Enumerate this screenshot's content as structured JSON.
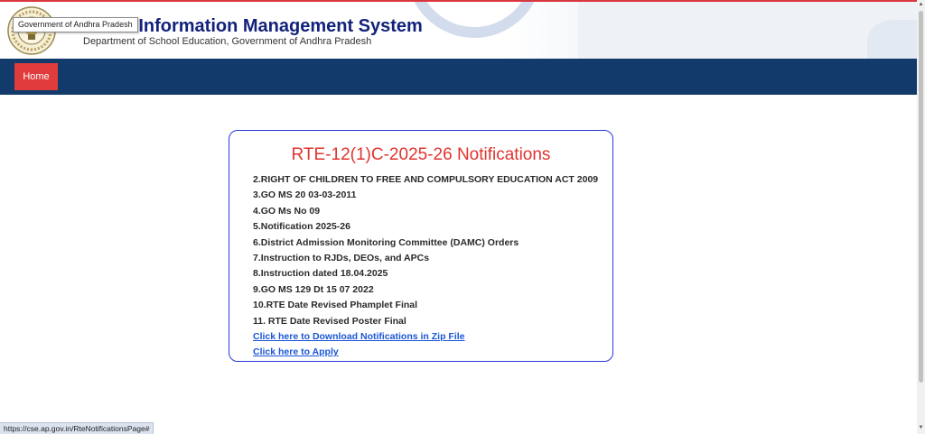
{
  "header": {
    "title": "ol Information Management System",
    "subtitle": "Department of School Education, Government of Andhra Pradesh",
    "emblem_tooltip": "Government of Andhra Pradesh",
    "title_color": "#12227a"
  },
  "nav": {
    "home_label": "Home",
    "bar_color": "#123a6a",
    "home_color": "#e03c3c"
  },
  "panel": {
    "title": "RTE-12(1)C-2025-26 Notifications",
    "title_color": "#e0342e",
    "border_color": "#2a3ad6",
    "items": [
      "2.RIGHT OF CHILDREN TO FREE AND COMPULSORY EDUCATION ACT 2009",
      "3.GO MS 20 03-03-2011",
      "4.GO Ms No 09",
      "5.Notification 2025-26",
      "6.District Admission Monitoring Committee (DAMC) Orders",
      "7.Instruction to RJDs, DEOs, and APCs",
      "8.Instruction dated 18.04.2025",
      "9.GO MS 129 Dt 15 07 2022",
      "10.RTE Date Revised Phamplet Final",
      "11. RTE Date Revised Poster Final"
    ],
    "links": {
      "download_zip": "Click here to Download Notifications in Zip File",
      "apply": "Click here to Apply"
    },
    "link_color": "#1a56d6"
  },
  "status_bar": {
    "url": "https://cse.ap.gov.in/RteNotificationsPage#"
  },
  "icons": {
    "emblem": "andhra-pradesh-emblem-icon"
  }
}
